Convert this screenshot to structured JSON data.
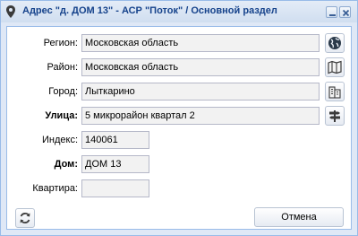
{
  "window": {
    "title": "Адрес \"д. ДОМ 13\" - АСР \"Поток\" / Основной раздел",
    "accent": "#15428b",
    "border": "#99bbe8"
  },
  "form": {
    "region": {
      "label": "Регион:",
      "value": "Московская область",
      "icon": "globe-icon"
    },
    "district": {
      "label": "Район:",
      "value": "Московская область",
      "icon": "map-icon"
    },
    "city": {
      "label": "Город:",
      "value": "Лыткарино",
      "icon": "buildings-icon"
    },
    "street": {
      "label": "Улица:",
      "value": "5 микрорайон квартал 2",
      "icon": "signpost-icon"
    },
    "index": {
      "label": "Индекс:",
      "value": "140061"
    },
    "house": {
      "label": "Дом:",
      "value": "ДОМ 13"
    },
    "apartment": {
      "label": "Квартира:",
      "value": ""
    }
  },
  "footer": {
    "refresh_icon": "refresh-icon",
    "cancel_label": "Отмена"
  }
}
